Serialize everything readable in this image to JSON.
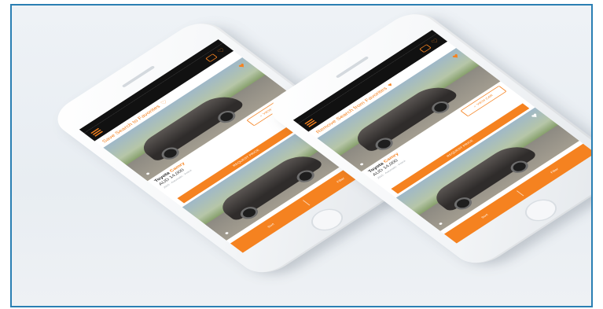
{
  "phones": [
    {
      "banner_text": "Save Search to Favorites",
      "banner_heart": "heart-outline-icon",
      "card": {
        "make": "Toyota",
        "model": "Camry",
        "price": "AUD 14,000",
        "meta": "2015 · Automatic · Petrol",
        "view_label": "VIEW CAR",
        "action_label": "REQUEST PRICE"
      },
      "tabs": [
        "Sort",
        "Filter"
      ]
    },
    {
      "banner_text": "Remove Search from Favorites",
      "banner_heart": "heart-filled-icon",
      "card": {
        "make": "Toyota",
        "model": "Camry",
        "price": "AUD 14,000",
        "meta": "2015 · Automatic · Petrol",
        "view_label": "VIEW CAR",
        "action_label": "REQUEST PRICE"
      },
      "tabs": [
        "Sort",
        "Filter"
      ]
    }
  ],
  "colors": {
    "accent": "#f58220",
    "frame_border": "#2a7fb3",
    "topbar": "#111111"
  }
}
